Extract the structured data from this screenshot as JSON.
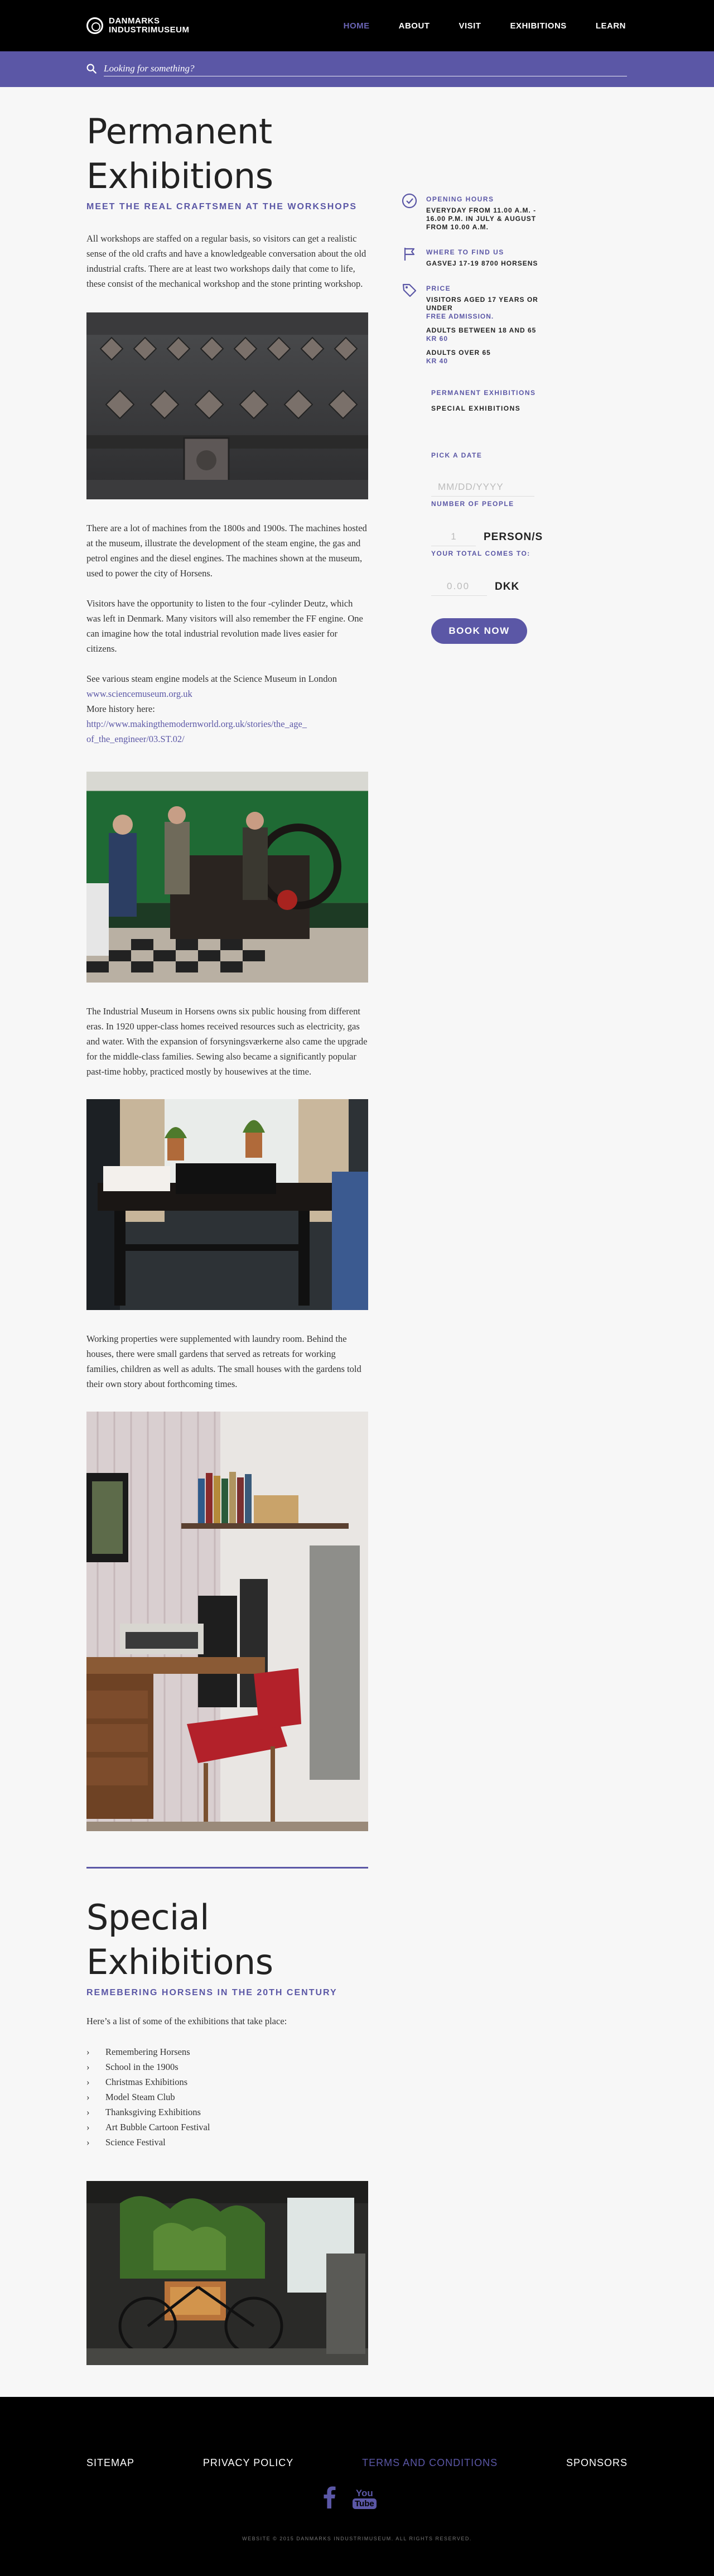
{
  "brand": {
    "line1": "DANMARKS",
    "line2": "INDUSTRIMUSEUM"
  },
  "nav": {
    "items": [
      {
        "label": "HOME",
        "active": true
      },
      {
        "label": "ABOUT",
        "active": false
      },
      {
        "label": "VISIT",
        "active": false
      },
      {
        "label": "EXHIBITIONS",
        "active": false
      },
      {
        "label": "LEARN",
        "active": false
      }
    ]
  },
  "search": {
    "placeholder": "Looking for something?"
  },
  "permanent": {
    "title": "Permanent Exhibitions",
    "subtitle": "MEET THE REAL CRAFTSMEN AT THE WORKSHOPS",
    "intro": "All workshops are staffed on a regular basis, so visitors can get a realistic sense of the old crafts and have a knowledgeable conversation about the old industrial crafts. There are at least two workshops daily that come to life, these consist of the mechanical workshop and the stone printing workshop.",
    "p2": "There are a lot of machines from the 1800s and 1900s. The machines hosted at the museum, illustrate the development of the steam engine, the gas and petrol engines and the diesel engines. The machines shown at the museum, used to power the city of Horsens.",
    "p3": "Visitors have the opportunity to listen to the four -cylinder Deutz, which was left in Denmark. Many visitors will also remember the FF engine. One can imagine how the total industrial revolution made lives easier for citizens.",
    "p4": "See various steam engine models at the Science Museum in London",
    "link1": "www.sciencemuseum.org.uk",
    "more_history": "More history here:",
    "link2": "http://www.makingthemodernworld.org.uk/stories/the_age_of_the_engineer/03.ST.02/",
    "p5": "The Industrial Museum in Horsens owns six public housing from different eras. In 1920 upper-class homes received resources such as electricity, gas and water. With the expansion of forsyningsværkerne also came the upgrade for the middle-class families. Sewing also became a significantly popular past-time hobby, practiced mostly by housewives at the time.",
    "p6": "Working properties were supplemented with laundry room. Behind the houses, there were small gardens that served as retreats for working families, children as well as adults. The small houses with the gardens told their own story about forthcoming times."
  },
  "info": {
    "hours_label": "OPENING HOURS",
    "hours_text": "EVERYDAY FROM 11.00 A.M. - 16.00 P.M. IN JULY & AUGUST FROM 10.00 A.M.",
    "where_label": "WHERE TO FIND US",
    "where_text": "GASVEJ 17-19 8700 HORSENS",
    "price_label": "PRICE",
    "price_line1": "VISITORS AGED 17 YEARS OR UNDER",
    "price_line1b": "FREE ADMISSION.",
    "price_line2": "ADULTS BETWEEN 18 AND 65",
    "price_line2b": "KR 60",
    "price_line3": "ADULTS OVER 65",
    "price_line3b": "KR 40"
  },
  "side_links": {
    "permanent": "PERMANENT EXHIBITIONS",
    "special": "SPECIAL EXHIBITIONS"
  },
  "booking": {
    "pick_date": "PICK A DATE",
    "date_placeholder": "MM/DD/YYYY",
    "people_label": "NUMBER OF PEOPLE",
    "people_value": "1",
    "unit": "PERSON/S",
    "total_label": "YOUR TOTAL COMES TO:",
    "total_value": "0.00",
    "currency": "DKK",
    "button": "BOOK NOW"
  },
  "special": {
    "title": "Special Exhibitions",
    "subtitle": "REMEBERING HORSENS IN THE 20TH CENTURY",
    "intro": "Here’s a list of some of the exhibitions that take place:",
    "items": [
      "Remembering Horsens",
      "School in the 1900s",
      "Christmas Exhibitions",
      "Model Steam Club",
      "Thanksgiving Exhibitions",
      "Art Bubble Cartoon Festival",
      "Science Festival"
    ]
  },
  "footer": {
    "links": [
      {
        "label": "SITEMAP",
        "active": false
      },
      {
        "label": "PRIVACY POLICY",
        "active": false
      },
      {
        "label": "TERMS AND CONDITIONS",
        "active": true
      },
      {
        "label": "SPONSORS",
        "active": false
      }
    ],
    "youtube_you": "You",
    "youtube_tube": "Tube",
    "copyright": "WEBSITE © 2015 DANMARKS INDUSTRIMUSEUM. ALL RIGHTS RESERVED."
  },
  "colors": {
    "accent": "#5b57a6",
    "header": "#000000",
    "background": "#f7f7f7"
  }
}
